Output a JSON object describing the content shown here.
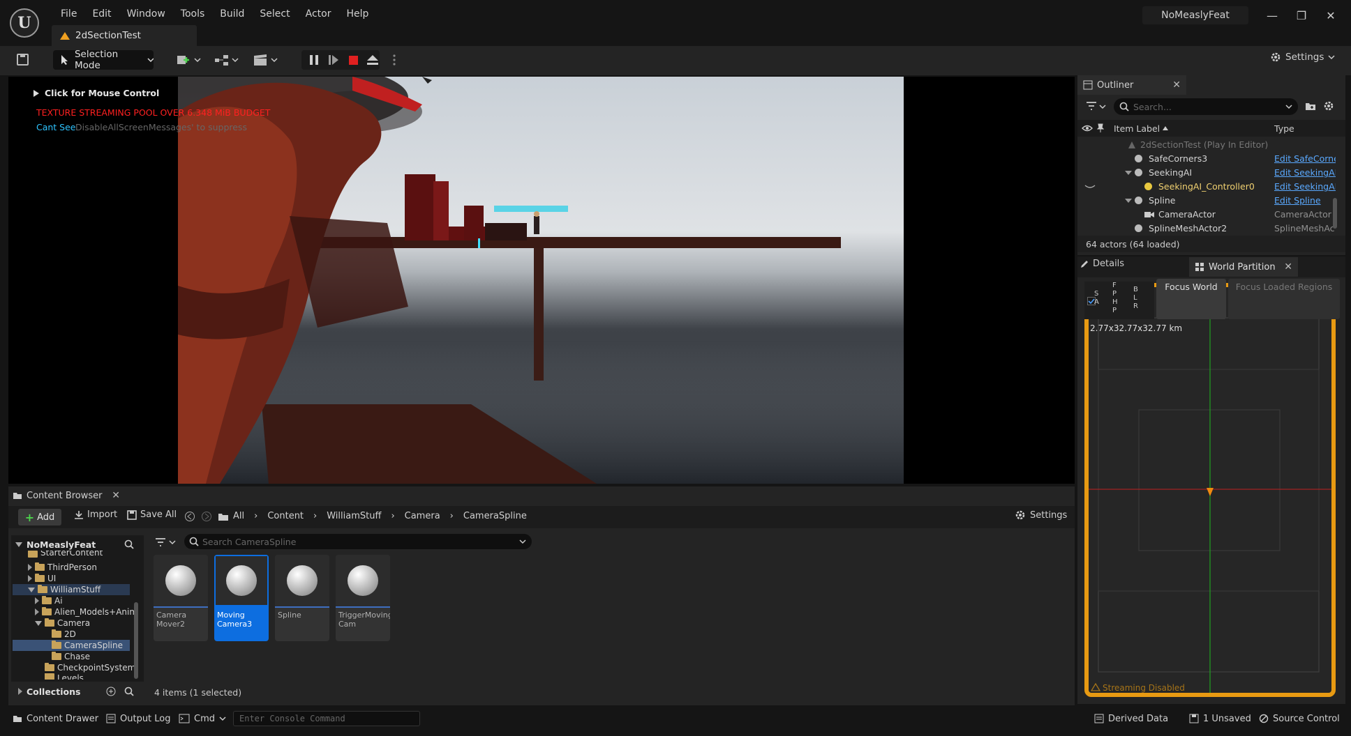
{
  "app": {
    "menu": [
      "File",
      "Edit",
      "Window",
      "Tools",
      "Build",
      "Select",
      "Actor",
      "Help"
    ],
    "document_tab": "2dSectionTest",
    "project_name": "NoMeaslyFeat",
    "window_controls": {
      "minimize": "—",
      "maximize": "❐",
      "close": "✕"
    }
  },
  "toolbar": {
    "selection_mode": "Selection Mode",
    "settings": "Settings"
  },
  "viewport": {
    "mouse_control": "Click for Mouse Control",
    "warning": "TEXTURE STREAMING POOL OVER 6.348 MiB BUDGET",
    "cant_see": "Cant See",
    "suppress_hint": "DisableAllScreenMessages' to suppress"
  },
  "outliner": {
    "tab": "Outliner",
    "search_placeholder": "Search...",
    "columns": {
      "label": "Item Label",
      "type": "Type"
    },
    "rows": [
      {
        "label": "2dSectionTest (Play In Editor)",
        "type": ""
      },
      {
        "label": "SafeCorners3",
        "type": "Edit SafeCorne"
      },
      {
        "label": "SeekingAI",
        "type": "Edit SeekingAI"
      },
      {
        "label": "SeekingAI_Controller0",
        "type": "Edit SeekingAI"
      },
      {
        "label": "Spline",
        "type": "Edit Spline"
      },
      {
        "label": "CameraActor",
        "type": "CameraActor"
      },
      {
        "label": "SplineMeshActor2",
        "type": "SplineMeshAc"
      }
    ],
    "actor_count": "64 actors (64 loaded)"
  },
  "world_partition": {
    "details_tab": "Details",
    "tab": "World Partition",
    "side_letters": [
      "S",
      "A",
      "F",
      "P",
      "H",
      "P",
      "B",
      "L",
      "R"
    ],
    "focus_world": "Focus World",
    "focus_loaded": "Focus Loaded Regions",
    "size_readout": "2.77x32.77x32.77 km",
    "streaming_status": "Streaming Disabled"
  },
  "content_browser": {
    "tab": "Content Browser",
    "add": "Add",
    "import": "Import",
    "save_all": "Save All",
    "breadcrumbs": [
      "All",
      "Content",
      "WilliamStuff",
      "Camera",
      "CameraSpline"
    ],
    "settings": "Settings",
    "tree_root": "NoMeaslyFeat",
    "tree": [
      {
        "label": "StarterContent",
        "depth": 2,
        "expanded": false
      },
      {
        "label": "ThirdPerson",
        "depth": 2,
        "expanded": false
      },
      {
        "label": "UI",
        "depth": 2,
        "expanded": false
      },
      {
        "label": "WilliamStuff",
        "depth": 2,
        "expanded": true
      },
      {
        "label": "Ai",
        "depth": 3,
        "expanded": false
      },
      {
        "label": "Alien_Models+Anim",
        "depth": 3,
        "expanded": false
      },
      {
        "label": "Camera",
        "depth": 3,
        "expanded": true
      },
      {
        "label": "2D",
        "depth": 4,
        "expanded": null
      },
      {
        "label": "CameraSpline",
        "depth": 4,
        "expanded": null
      },
      {
        "label": "Chase",
        "depth": 4,
        "expanded": null
      },
      {
        "label": "CheckpointSystem",
        "depth": 3,
        "expanded": null
      },
      {
        "label": "Levels",
        "depth": 3,
        "expanded": null
      }
    ],
    "collections": "Collections",
    "search_placeholder": "Search CameraSpline",
    "assets": [
      {
        "name": "Camera Mover2",
        "selected": false
      },
      {
        "name": "Moving Camera3",
        "selected": true
      },
      {
        "name": "Spline",
        "selected": false
      },
      {
        "name": "TriggerMoving Cam",
        "selected": false
      }
    ],
    "item_count": "4 items (1 selected)"
  },
  "statusbar": {
    "content_drawer": "Content Drawer",
    "output_log": "Output Log",
    "cmd": "Cmd",
    "console_placeholder": "Enter Console Command",
    "derived_data": "Derived Data",
    "unsaved": "1 Unsaved",
    "source_control": "Source Control"
  }
}
